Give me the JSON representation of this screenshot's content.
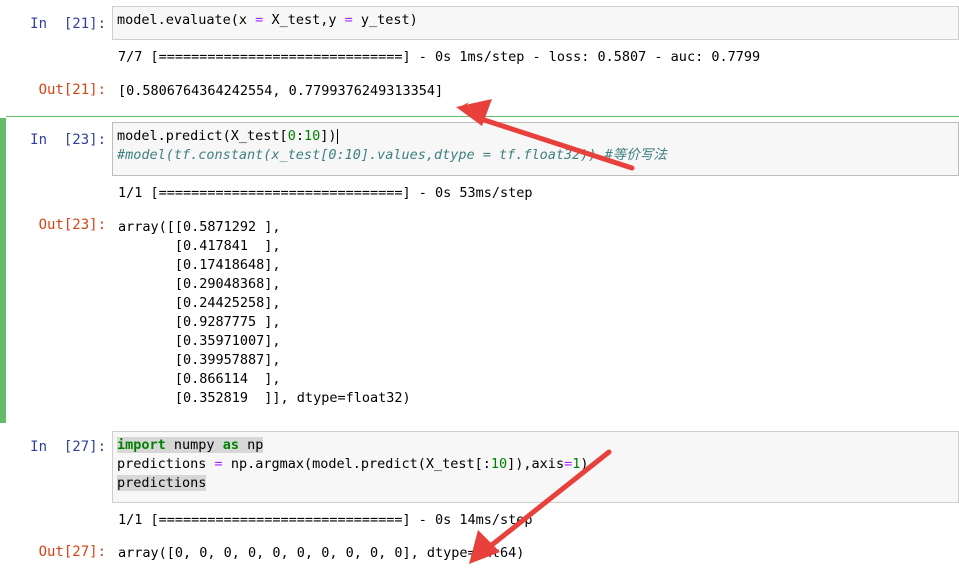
{
  "cells": [
    {
      "in_prompt": "In  [21]:",
      "code": [
        "model.evaluate(x = X_test,y = y_test)"
      ],
      "stream": "7/7 [==============================] - 0s 1ms/step - loss: 0.5807 - auc: 0.7799",
      "out_prompt": "Out[21]:",
      "result": "[0.5806764364242554, 0.7799376249313354]"
    },
    {
      "in_prompt": "In  [23]:",
      "code": [
        "model.predict(X_test[0:10])",
        "#model(tf.constant(x_test[0:10].values,dtype = tf.float32)) #等价写法"
      ],
      "stream": "1/1 [==============================] - 0s 53ms/step",
      "out_prompt": "Out[23]:",
      "result_lines": [
        "array([[0.5871292 ],",
        "       [0.417841  ],",
        "       [0.17418648],",
        "       [0.29048368],",
        "       [0.24425258],",
        "       [0.9287775 ],",
        "       [0.35971007],",
        "       [0.39957887],",
        "       [0.866114  ],",
        "       [0.352819  ]], dtype=float32)"
      ]
    },
    {
      "in_prompt": "In  [27]:",
      "code": [
        "import numpy as np",
        "predictions = np.argmax(model.predict(X_test[:10]),axis=1)",
        "predictions"
      ],
      "stream": "1/1 [==============================] - 0s 14ms/step",
      "out_prompt": "Out[27]:",
      "result": "array([0, 0, 0, 0, 0, 0, 0, 0, 0, 0], dtype=int64)"
    }
  ],
  "colors": {
    "in_prompt": "#303f9f",
    "out_prompt": "#d84315",
    "selected_bar": "#66bb6a",
    "arrow": "#e8413c"
  },
  "annotations": [
    "red-arrow",
    "red-arrow"
  ]
}
